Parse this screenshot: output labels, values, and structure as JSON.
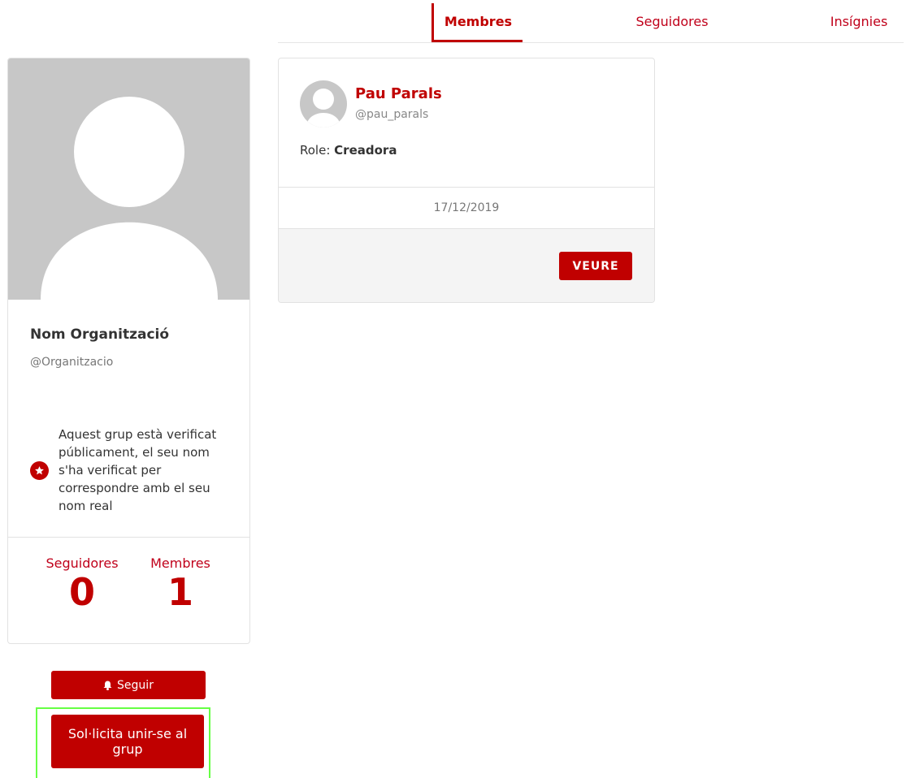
{
  "tabs": [
    {
      "label": "Membres",
      "active": true
    },
    {
      "label": "Seguidores",
      "active": false
    },
    {
      "label": "Insígnies",
      "active": false
    }
  ],
  "profile": {
    "name": "Nom Organització",
    "handle": "@Organitzacio",
    "verified_icon": "star-badge-icon",
    "verified_text": "Aquest grup està verificat públicament, el seu nom s'ha verificat per correspondre amb el seu nom real",
    "stats": {
      "followers_label": "Seguidores",
      "followers_value": "0",
      "members_label": "Membres",
      "members_value": "1"
    }
  },
  "actions": {
    "follow_icon": "bell-icon",
    "follow_label": "Seguir",
    "join_label": "Sol·licita unir-se al grup"
  },
  "member": {
    "name": "Pau Parals",
    "handle": "@pau_parals",
    "role_label": "Role:",
    "role_value": "Creadora",
    "date": "17/12/2019",
    "view_label": "VEURE"
  },
  "colors": {
    "accent": "#c00000",
    "avatar_placeholder": "#c7c7c7",
    "highlight_border": "#66ff44"
  }
}
